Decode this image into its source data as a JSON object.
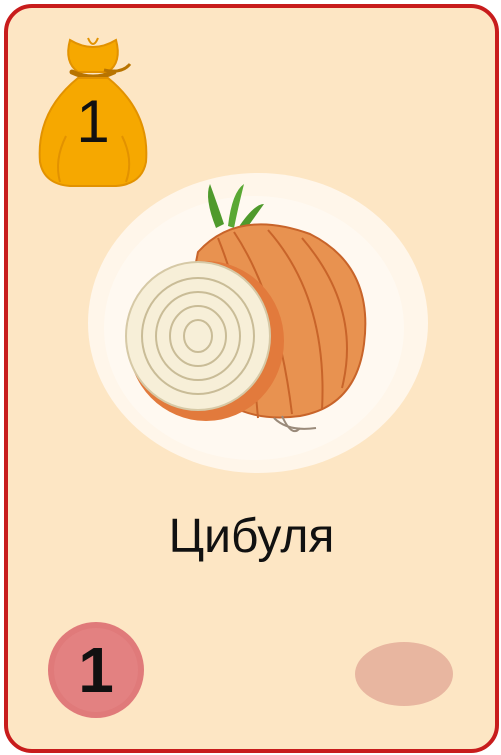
{
  "card": {
    "name": "Цибуля",
    "cost": "1",
    "points": "1",
    "image": "onion-illustration",
    "colors": {
      "background": "#fde6c4",
      "border": "#c81c1c",
      "bag": "#f6a800",
      "badge": "#e07a7a",
      "token": "#e8b6a0"
    }
  }
}
